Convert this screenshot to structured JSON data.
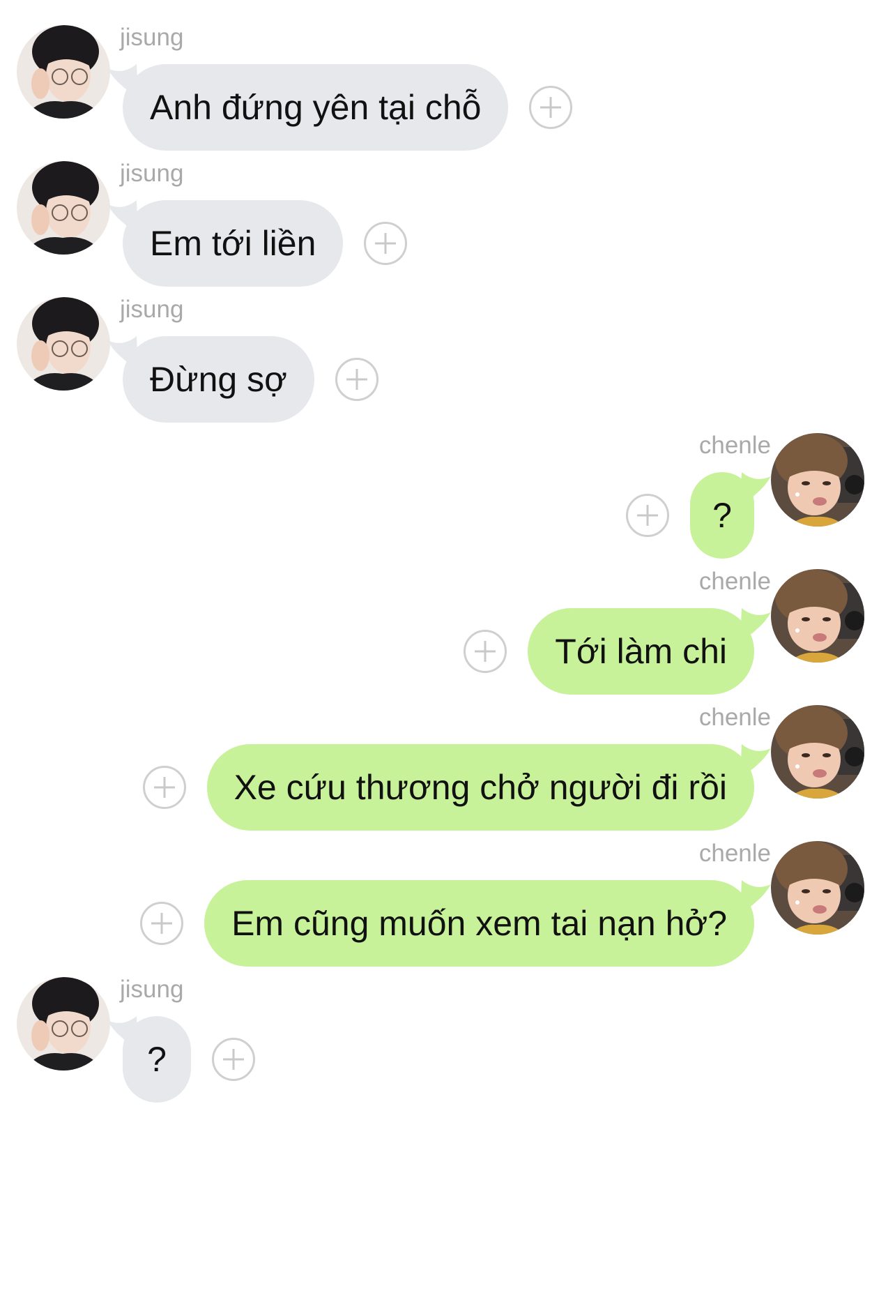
{
  "users": {
    "left": {
      "name": "jisung",
      "bubble_color": "#e6e8ec"
    },
    "right": {
      "name": "chenle",
      "bubble_color": "#c8f29a"
    }
  },
  "messages": [
    {
      "sender": "jisung",
      "side": "left",
      "text": "Anh đứng yên tại chỗ"
    },
    {
      "sender": "jisung",
      "side": "left",
      "text": "Em tới liền"
    },
    {
      "sender": "jisung",
      "side": "left",
      "text": "Đừng sợ"
    },
    {
      "sender": "chenle",
      "side": "right",
      "text": "?"
    },
    {
      "sender": "chenle",
      "side": "right",
      "text": "Tới làm chi"
    },
    {
      "sender": "chenle",
      "side": "right",
      "text": "Xe cứu thương chở người đi rồi"
    },
    {
      "sender": "chenle",
      "side": "right",
      "text": "Em cũng muốn xem tai nạn hở?"
    },
    {
      "sender": "jisung",
      "side": "left",
      "text": "?"
    }
  ],
  "icons": {
    "add_reaction": "plus-circle-icon",
    "avatar_left": "avatar-jisung",
    "avatar_right": "avatar-chenle"
  }
}
